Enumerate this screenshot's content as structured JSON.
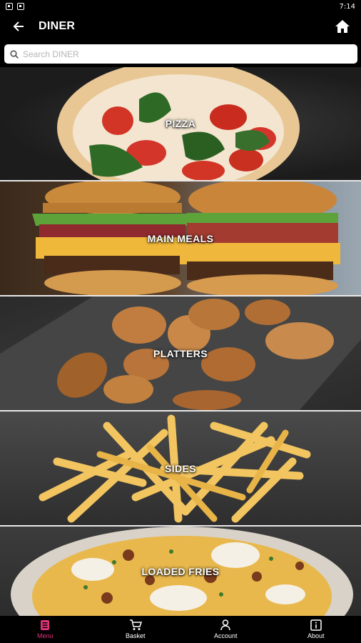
{
  "status_bar": {
    "time": "7:14"
  },
  "header": {
    "title": "DINER",
    "back_icon": "arrow-back-icon",
    "home_icon": "home-icon"
  },
  "search": {
    "placeholder": "Search DINER",
    "value": ""
  },
  "categories": [
    {
      "label": "PIZZA"
    },
    {
      "label": "MAIN MEALS"
    },
    {
      "label": "PLATTERS"
    },
    {
      "label": "SIDES"
    },
    {
      "label": "LOADED FRIES"
    }
  ],
  "bottom_nav": {
    "items": [
      {
        "label": "Menu",
        "icon": "menu-list-icon",
        "active": true
      },
      {
        "label": "Basket",
        "icon": "cart-icon",
        "active": false
      },
      {
        "label": "Account",
        "icon": "person-icon",
        "active": false
      },
      {
        "label": "About",
        "icon": "info-icon",
        "active": false
      }
    ]
  },
  "colors": {
    "accent": "#e0337a",
    "background": "#000000"
  }
}
